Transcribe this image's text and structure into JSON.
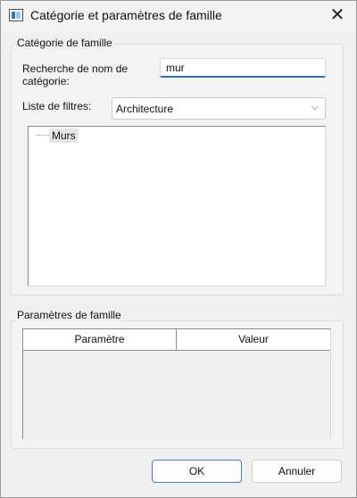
{
  "window": {
    "title": "Catégorie et paramètres de famille",
    "close_glyph": "✕"
  },
  "category_group": {
    "label": "Catégorie de famille",
    "search_label": "Recherche de nom de catégorie:",
    "search_value": "mur",
    "filter_label": "Liste de filtres:",
    "filter_selected": "Architecture",
    "tree_items": [
      {
        "label": "Murs"
      }
    ]
  },
  "params_group": {
    "label": "Paramètres de famille",
    "columns": [
      "Paramètre",
      "Valeur"
    ]
  },
  "buttons": {
    "ok": "OK",
    "cancel": "Annuler"
  }
}
